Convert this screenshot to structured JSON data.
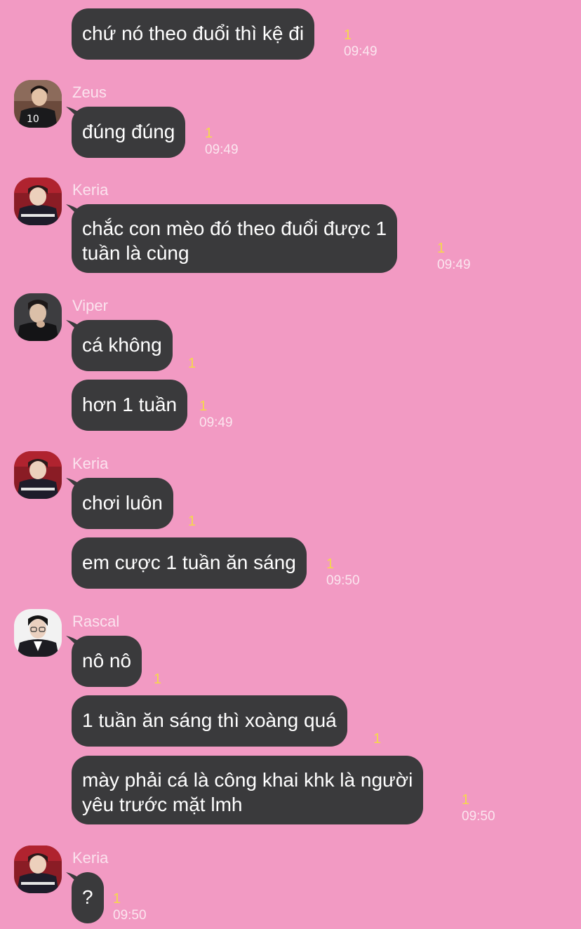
{
  "colors": {
    "background": "#f29ac3",
    "bubble": "#3a3a3c",
    "unread": "#f5d94a",
    "name": "#fbe3ee"
  },
  "messages": [
    {
      "text": "chứ nó theo đuổi thì kệ đi",
      "unread": "1",
      "time": "09:49"
    },
    {
      "sender": "Zeus",
      "text": "đúng đúng",
      "unread": "1",
      "time": "09:49"
    },
    {
      "sender": "Keria",
      "line1": "chắc con mèo đó theo đuổi được 1",
      "line2": "tuần là cùng",
      "unread": "1",
      "time": "09:49"
    },
    {
      "sender": "Viper",
      "text": "cá không",
      "unread": "1"
    },
    {
      "text": "hơn 1 tuần",
      "unread": "1",
      "time": "09:49"
    },
    {
      "sender": "Keria",
      "text": "chơi luôn",
      "unread": "1"
    },
    {
      "text": "em cược 1 tuần ăn sáng",
      "unread": "1",
      "time": "09:50"
    },
    {
      "sender": "Rascal",
      "text": "nô nô",
      "unread": "1"
    },
    {
      "text": "1 tuần ăn sáng thì xoàng quá",
      "unread": "1"
    },
    {
      "line1": "mày phải cá là công khai khk là người",
      "line2": "yêu trước mặt lmh",
      "unread": "1",
      "time": "09:50"
    },
    {
      "sender": "Keria",
      "text": "?",
      "unread": "1",
      "time": "09:50"
    }
  ]
}
